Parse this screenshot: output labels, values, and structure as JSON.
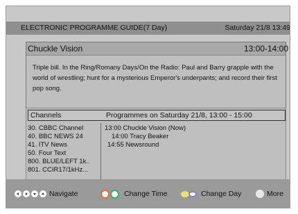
{
  "header": {
    "title": "ELECTRONIC PROGRAMME GUIDE(7 Day)",
    "datetime": "Saturday 21/8 13:49"
  },
  "selected_programme": {
    "title": "Chuckle Vision",
    "time": "13:00-14:00",
    "description": "Triple bill. In the Ring/Romany Days/On the Radio: Paul and Barry grapple with the world of wrestling; hunt for a mysterious Emperor's underpants; and record their first pop song."
  },
  "grid": {
    "channels_header": "Channels",
    "programmes_header": "Programmes on Saturday 21/8,  13:00 - 15:00",
    "channels": [
      "30. CBBC Channel",
      "40. BBC NEWS 24",
      "41. ITV News",
      "50. Four Text",
      "800. BLUE/LEFT 1k..",
      "801. CCIR17/1kHz..."
    ],
    "programmes": [
      "13:00 Chuckle Vision (Now)",
      "14:00 Tracy Beaker",
      "14:55 Newsround"
    ]
  },
  "footer": {
    "navigate_label": "Navigate",
    "change_time_label": "Change Time",
    "change_day_label": "Change  Day",
    "more_label": "More",
    "colors": {
      "red": "#f06a32",
      "green": "#2fb36a",
      "yellow": "#e8e36a",
      "blue": "#8a7fd0",
      "white": "#e8e8e8"
    }
  }
}
